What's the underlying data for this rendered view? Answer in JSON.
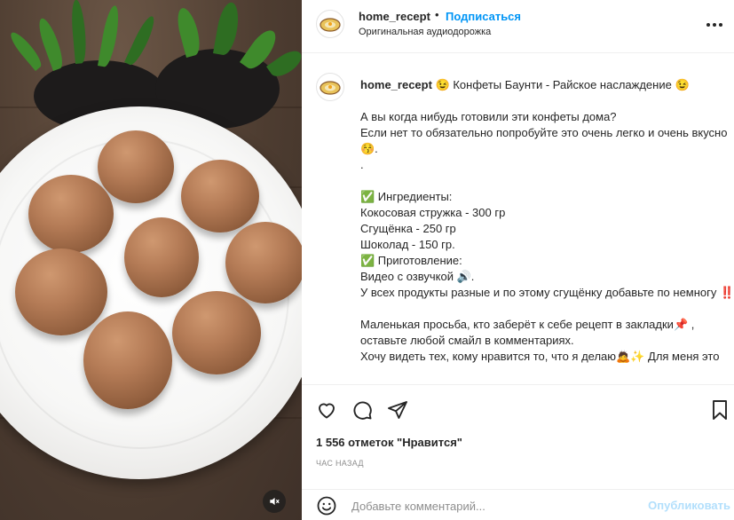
{
  "post": {
    "username": "home_recept",
    "follow_label": "Подписаться",
    "audio_label": "Оригинальная аудиодорожка"
  },
  "caption": {
    "username": "home_recept",
    "text": "😉 Конфеты Баунти - Райское наслаждение 😉\n\nА вы когда нибудь готовили эти конфеты дома?\nЕсли нет то обязательно попробуйте это очень легко и очень вкусно 😚.\n.\n\n✅ Ингредиенты:\nКокосовая стружка - 300 гр\nСгущёнка - 250 гр\nШоколад - 150 гр.\n✅ Приготовление:\nВидео с озвучкой 🔊.\nУ всех продукты разные и по этому сгущёнку добавьте по немногу ‼️\n\nМаленькая просьба, кто заберёт к себе рецепт в закладки📌 , оставьте любой смайл в комментариях.\nХочу видеть тех, кому нравится то, что я делаю🙇✨ Для меня это"
  },
  "stats": {
    "likes": "1 556 отметок \"Нравится\"",
    "time": "ЧАС НАЗАД"
  },
  "comment": {
    "placeholder": "Добавьте комментарий...",
    "post_label": "Опубликовать"
  },
  "icons": {
    "like": "heart-icon",
    "comment": "comment-bubble-icon",
    "share": "paper-plane-icon",
    "save": "bookmark-icon",
    "emoji": "smiley-icon",
    "more": "more-dots-icon",
    "mute": "sound-off-icon"
  },
  "colors": {
    "link": "#0095f6",
    "post_disabled": "#b2dffc",
    "muted_text": "#8e8e8e"
  }
}
